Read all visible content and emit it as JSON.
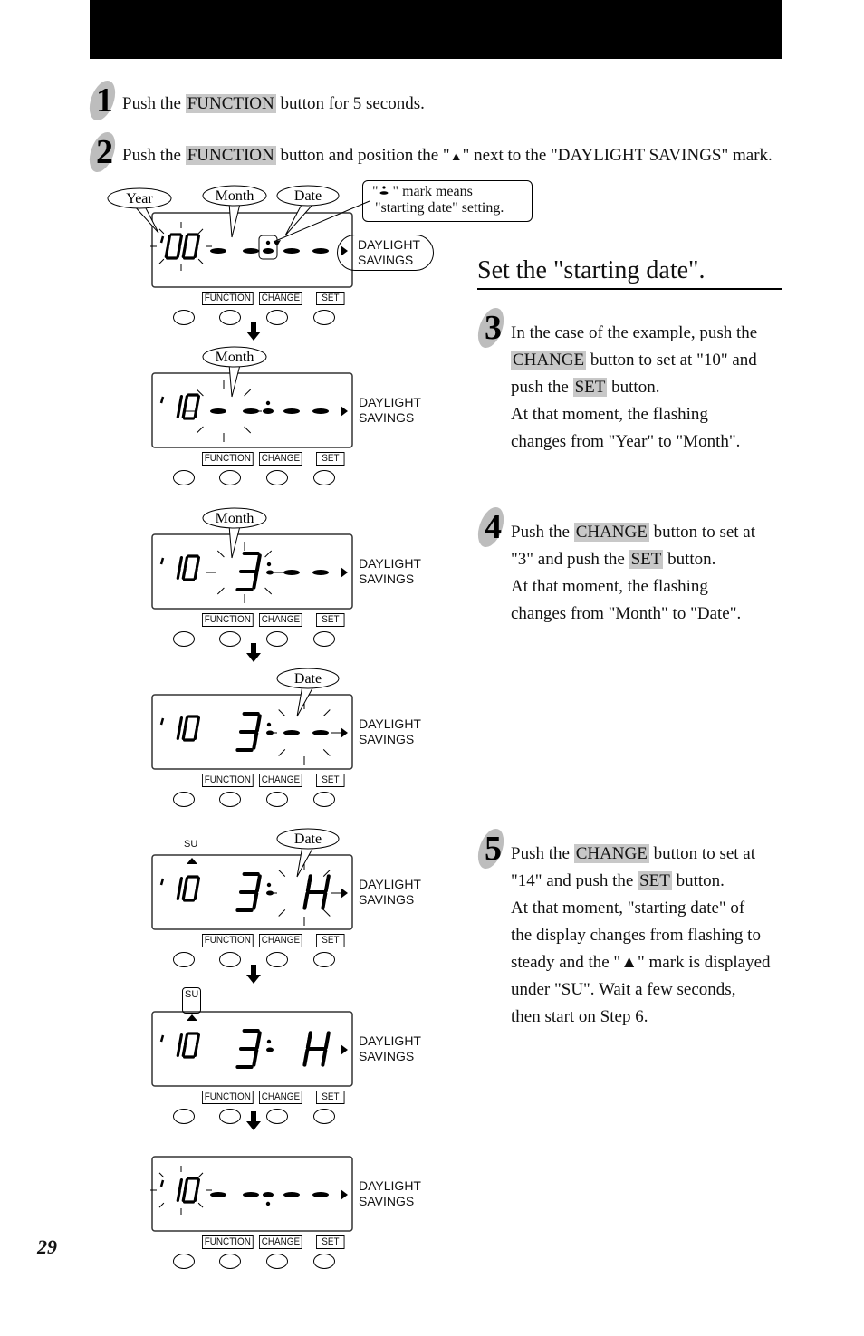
{
  "header_bar_color": "#000000",
  "highlight_color": "#c8c8c8",
  "steps_top": [
    {
      "number": "1",
      "parts": [
        "Push the ",
        "FUNCTION",
        " button for 5 seconds."
      ]
    },
    {
      "number": "2",
      "parts": [
        "Push the ",
        "FUNCTION",
        " button and position the  \"",
        "▲",
        "\" next to the \"DAYLIGHT SAVINGS\" mark."
      ]
    }
  ],
  "callout": {
    "line1_prefix": "\"",
    "line1_suffix": " \" mark means",
    "line2": "\"starting date\" setting."
  },
  "section_title": "Set the \"starting date\".",
  "steps_right": [
    {
      "number": "3",
      "lines": [
        [
          "In the case of the example, push the"
        ],
        [
          "CHANGE",
          " button to set at \"10\" and"
        ],
        [
          "push the ",
          "SET",
          " button."
        ],
        [
          "At that moment, the flashing"
        ],
        [
          "changes from \"Year\" to \"Month\"."
        ]
      ]
    },
    {
      "number": "4",
      "lines": [
        [
          "Push the ",
          "CHANGE",
          " button to set at"
        ],
        [
          "\"3\" and push the ",
          "SET",
          " button."
        ],
        [
          "At that moment, the flashing"
        ],
        [
          "changes from \"Month\" to \"Date\"."
        ]
      ]
    },
    {
      "number": "5",
      "lines": [
        [
          "Push the ",
          "CHANGE",
          " button to set at"
        ],
        [
          "\"14\" and push the ",
          "SET",
          " button."
        ],
        [
          "At that moment, \"starting date\" of"
        ],
        [
          "the display changes from flashing to"
        ],
        [
          "steady and the \"▲\" mark is displayed"
        ],
        [
          "under \"SU\". Wait a few seconds,"
        ],
        [
          "then start on Step 6."
        ]
      ]
    }
  ],
  "buttons": {
    "function": "FUNCTION",
    "change": "CHANGE",
    "set": "SET"
  },
  "daylight_label": {
    "line1": "DAYLIGHT",
    "line2": "SAVINGS"
  },
  "bubbles": {
    "year": "Year",
    "month": "Month",
    "date": "Date"
  },
  "su_label": "SU",
  "displays": [
    {
      "year": "00",
      "month": "--",
      "date": "--",
      "flashing": "year",
      "bubbles": [
        "year",
        "month",
        "date"
      ],
      "marker_box": true,
      "su": false
    },
    {
      "year": "10",
      "month": "--",
      "date": "--",
      "flashing": "month",
      "bubbles": [
        "month"
      ],
      "su": false
    },
    {
      "year": "10",
      "month": "3",
      "date": "--",
      "flashing": "month",
      "bubbles": [
        "month"
      ],
      "su": false
    },
    {
      "year": "10",
      "month": "3",
      "date": "--",
      "flashing": "date",
      "bubbles": [
        "date"
      ],
      "su": false
    },
    {
      "year": "10",
      "month": "3",
      "date": "14",
      "flashing": "date",
      "bubbles": [
        "date"
      ],
      "su": true
    },
    {
      "year": "10",
      "month": "3",
      "date": "14",
      "flashing": "none",
      "bubbles": [],
      "su": true,
      "su_boxed": true
    },
    {
      "year": "10",
      "month": "--",
      "date": "--",
      "flashing": "year",
      "bubbles": [],
      "su": false,
      "dot_below": true
    }
  ],
  "page_number": "29"
}
